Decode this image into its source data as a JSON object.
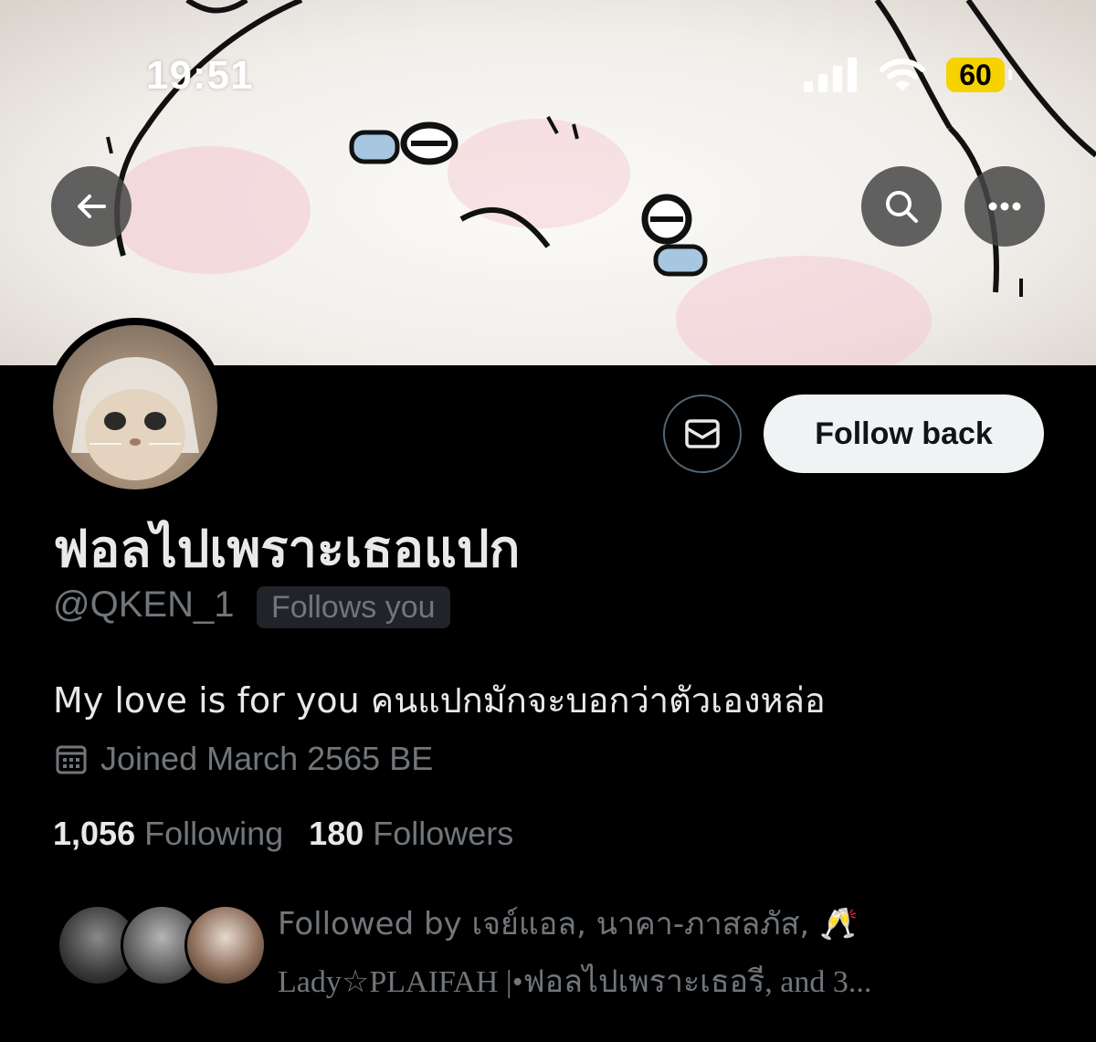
{
  "status_bar": {
    "time": "19:51",
    "battery": "60",
    "icons": [
      "signal-icon",
      "wifi-icon",
      "battery-icon"
    ]
  },
  "header_buttons": {
    "back": "back-arrow-icon",
    "search": "search-icon",
    "more": "more-icon"
  },
  "profile": {
    "display_name": "ฟอลไปเพราะเธอแปก",
    "handle": "@QKEN_1",
    "follows_you": "Follows you",
    "bio": "My love is for you คนแปกมักจะบอกว่าตัวเองหล่อ",
    "joined": "Joined March 2565 BE",
    "following_count": "1,056",
    "following_label": "Following",
    "followers_count": "180",
    "followers_label": "Followers"
  },
  "actions": {
    "follow_back": "Follow back",
    "message_icon": "envelope-icon"
  },
  "followed_by": {
    "line1": "Followed by เจย์แอล, นาคา-ภาสลภัส, 🥂",
    "line2": "Lady☆PLAIFAH |•ฟอลไปเพราะเธอรี, and 3..."
  },
  "colors": {
    "background": "#000000",
    "primary_text": "#e7e9ea",
    "secondary_text": "#71767b",
    "battery": "#f5d200",
    "follow_button": "#eff3f4"
  }
}
